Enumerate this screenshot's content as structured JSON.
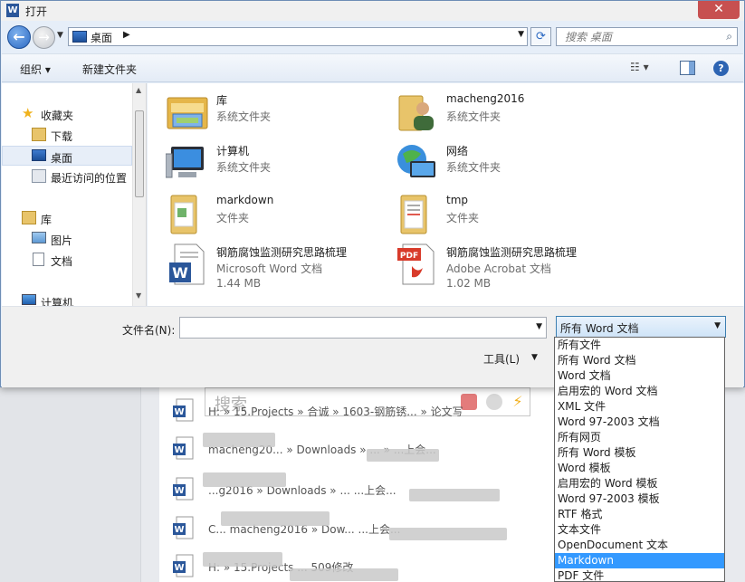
{
  "window": {
    "title": "打开",
    "app_icon": "W"
  },
  "address": {
    "location": "桌面",
    "search_placeholder": "搜索 桌面"
  },
  "toolbar": {
    "organize": "组织 ▾",
    "new_folder": "新建文件夹"
  },
  "nav": {
    "favorites": "收藏夹",
    "downloads": "下载",
    "desktop": "桌面",
    "recent": "最近访问的位置",
    "libraries": "库",
    "pictures": "图片",
    "documents": "文档",
    "computer": "计算机"
  },
  "files": [
    {
      "name": "库",
      "type": "系统文件夹",
      "icon": "library-icon"
    },
    {
      "name": "macheng2016",
      "type": "系统文件夹",
      "icon": "user-folder-icon"
    },
    {
      "name": "计算机",
      "type": "系统文件夹",
      "icon": "computer-icon"
    },
    {
      "name": "网络",
      "type": "系统文件夹",
      "icon": "network-icon"
    },
    {
      "name": "markdown",
      "type": "文件夹",
      "icon": "folder-icon"
    },
    {
      "name": "tmp",
      "type": "文件夹",
      "icon": "folder-icon"
    },
    {
      "name": "钢筋腐蚀监测研究思路梳理",
      "type": "Microsoft Word 文档",
      "size": "1.44 MB",
      "icon": "word-doc-icon"
    },
    {
      "name": "钢筋腐蚀监测研究思路梳理",
      "type": "Adobe Acrobat 文档",
      "size": "1.02 MB",
      "icon": "pdf-doc-icon"
    }
  ],
  "bottom": {
    "filename_label": "文件名(N):",
    "filename_value": "",
    "filetype_selected": "所有 Word 文档",
    "tools": "工具(L)"
  },
  "filetype_options": [
    "所有文件",
    "所有 Word 文档",
    "Word 文档",
    "启用宏的 Word 文档",
    "XML 文件",
    "Word 97-2003 文档",
    "所有网页",
    "所有 Word 模板",
    "Word 模板",
    "启用宏的 Word 模板",
    "Word 97-2003 模板",
    "RTF 格式",
    "文本文件",
    "OpenDocument 文本",
    "Markdown",
    "PDF 文件"
  ],
  "highlighted_option": "Markdown",
  "background": {
    "search_text": "搜索",
    "rows": [
      "H: » 15.Projects » 合诚 » 1603-钢筋锈... » 论文写",
      "macheng20... » Downloads » ... » ...上会...",
      "...g2016 » Downloads » ... ...上会...",
      "C... macheng2016 » Dow... ...上会...",
      "H: » 15.Projects ... 509修改"
    ]
  },
  "colors": {
    "accent": "#3399ff",
    "selection": "#e7eef8",
    "close": "#c75050"
  }
}
